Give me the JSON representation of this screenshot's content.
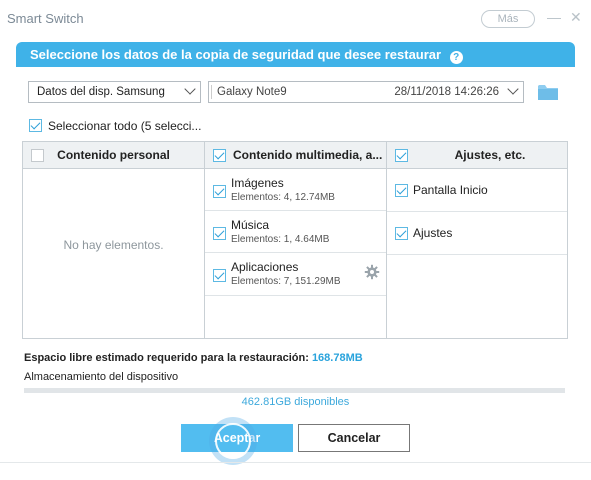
{
  "window": {
    "app_title": "Smart Switch",
    "more_label": "Más",
    "minimize_glyph": "—",
    "close_glyph": "✕"
  },
  "dialog": {
    "header": "Seleccione los datos de la copia de seguridad que desee restaurar",
    "help_glyph": "?",
    "device_select": {
      "value": "Datos del disp. Samsung"
    },
    "backup_select": {
      "name": "Galaxy Note9",
      "date": "28/11/2018 14:26:26"
    },
    "folder_icon": "folder-icon",
    "select_all": {
      "label": "Seleccionar todo (5 selecci...",
      "checked": true
    }
  },
  "columns": {
    "personal": {
      "header": "Contenido personal",
      "checked": false,
      "empty_text": "No hay elementos."
    },
    "multimedia": {
      "header": "Contenido multimedia, a...",
      "checked": true,
      "items": [
        {
          "name": "Imágenes",
          "detail": "Elementos: 4, 12.74MB",
          "checked": true
        },
        {
          "name": "Música",
          "detail": "Elementos: 1, 4.64MB",
          "checked": true
        },
        {
          "name": "Aplicaciones",
          "detail": "Elementos: 7, 151.29MB",
          "checked": true
        }
      ]
    },
    "settings": {
      "header": "Ajustes, etc.",
      "checked": true,
      "items": [
        {
          "name": "Pantalla Inicio",
          "checked": true
        },
        {
          "name": "Ajustes",
          "checked": true
        }
      ]
    }
  },
  "storage": {
    "required_label": "Espacio libre estimado requerido para la restauración:",
    "required_value": "168.78MB",
    "location_label": "Almacenamiento del dispositivo",
    "used_fraction": 0.0,
    "available_text": "462.81GB disponibles"
  },
  "buttons": {
    "accept": "Aceptar",
    "cancel": "Cancelar"
  },
  "colors": {
    "accent": "#3fb2e8",
    "accept_button": "#52bdf0",
    "value_text": "#29a3dc"
  }
}
